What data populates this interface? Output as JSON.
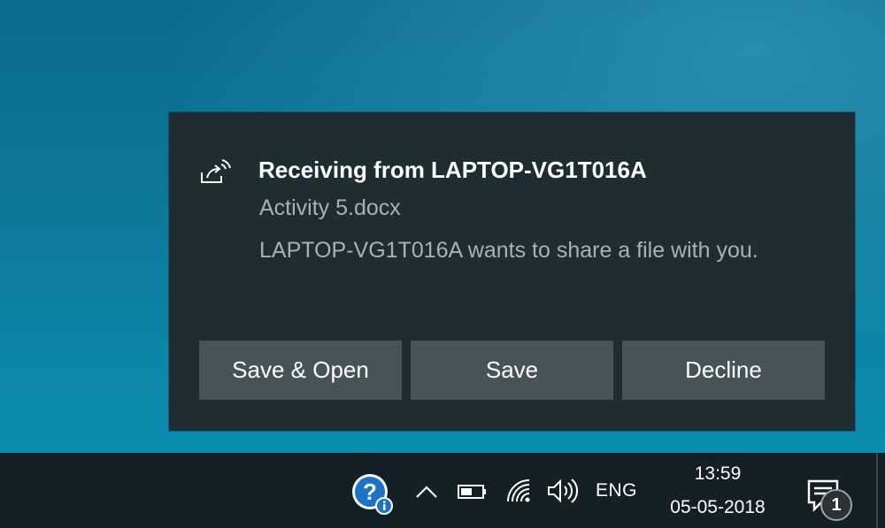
{
  "toast": {
    "icon": "nearby-share-icon",
    "title": "Receiving from LAPTOP-VG1T016A",
    "file_name": "Activity 5.docx",
    "message": "LAPTOP-VG1T016A wants to share a file with you.",
    "buttons": [
      {
        "label": "Save & Open"
      },
      {
        "label": "Save"
      },
      {
        "label": "Decline"
      }
    ]
  },
  "taskbar": {
    "tray_icons": [
      "help-icon",
      "chevron-up-icon",
      "battery-icon",
      "wifi-icon",
      "volume-icon"
    ],
    "language": "ENG",
    "time": "13:59",
    "date": "05-05-2018",
    "notification_count": "1"
  },
  "colors": {
    "toast_background": "#1f2d33",
    "button_background": "#46545a",
    "taskbar_background": "#152026",
    "help_icon_blue": "#1a73c7"
  }
}
